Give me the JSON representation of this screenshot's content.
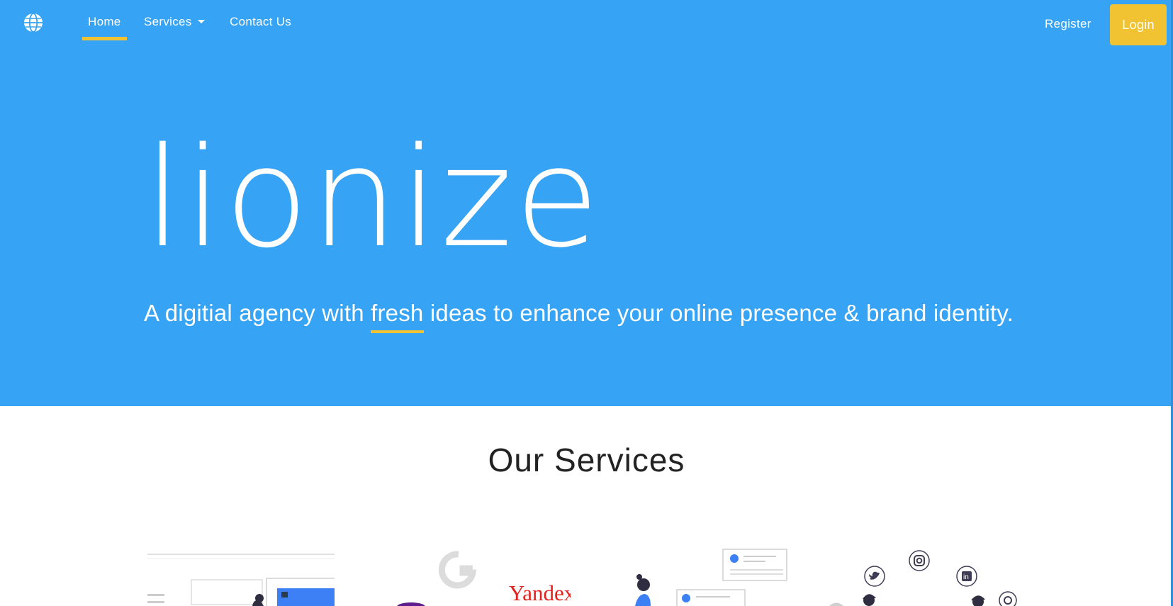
{
  "nav": {
    "home_label": "Home",
    "services_label": "Services",
    "contact_label": "Contact Us",
    "register_label": "Register",
    "login_label": "Login"
  },
  "hero": {
    "brand": "lionize",
    "tagline_before": "A digitial agency with ",
    "tagline_highlight": "fresh",
    "tagline_after": " ideas to enhance your online presence & brand identity."
  },
  "services": {
    "title": "Our Services",
    "illustrations": [
      {
        "icon": "web-design-illustration"
      },
      {
        "icon": "search-engines-illustration",
        "logo_text": "Yandex"
      },
      {
        "icon": "online-forms-illustration"
      },
      {
        "icon": "social-media-illustration"
      }
    ]
  },
  "colors": {
    "hero_bg": "#36a3f4",
    "accent": "#f1c232",
    "text_dark": "#222222"
  }
}
